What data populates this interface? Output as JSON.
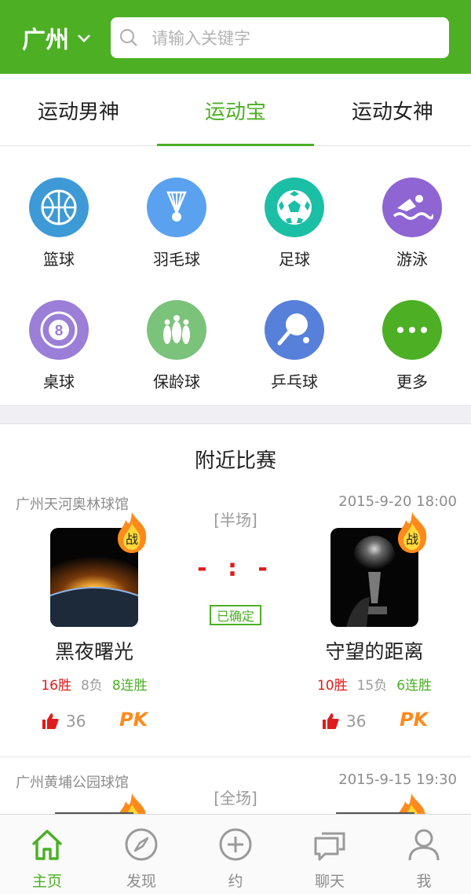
{
  "header": {
    "city": "广州",
    "search_placeholder": "请输入关键字"
  },
  "tabs": [
    {
      "label": "运动男神",
      "active": false
    },
    {
      "label": "运动宝",
      "active": true
    },
    {
      "label": "运动女神",
      "active": false
    }
  ],
  "categories": [
    {
      "label": "篮球",
      "icon": "basketball-icon",
      "color": "#3d9ad6"
    },
    {
      "label": "羽毛球",
      "icon": "badminton-icon",
      "color": "#5aa2ef"
    },
    {
      "label": "足球",
      "icon": "soccer-icon",
      "color": "#1bbfa6"
    },
    {
      "label": "游泳",
      "icon": "swimming-icon",
      "color": "#8e65d2"
    },
    {
      "label": "桌球",
      "icon": "billiards-icon",
      "color": "#9a7ed8"
    },
    {
      "label": "保龄球",
      "icon": "bowling-icon",
      "color": "#7bc27a"
    },
    {
      "label": "乒乓球",
      "icon": "pingpong-icon",
      "color": "#5680d9"
    },
    {
      "label": "更多",
      "icon": "more-icon",
      "color": "#4caf24"
    }
  ],
  "section_title": "附近比赛",
  "matches": [
    {
      "venue": "广州天河奥林球馆",
      "time": "2015-9-20   18:00",
      "mode": "[半场]",
      "score": "- : -",
      "status": "已确定",
      "badge": "战",
      "home": {
        "name": "黑夜曙光",
        "wins": "16胜",
        "losses": "8负",
        "streak": "8连胜",
        "likes": "36",
        "pk": "PK"
      },
      "away": {
        "name": "守望的距离",
        "wins": "10胜",
        "losses": "15负",
        "streak": "6连胜",
        "likes": "36",
        "pk": "PK"
      }
    },
    {
      "venue": "广州黄埔公园球馆",
      "time": "2015-9-15   19:30",
      "mode": "[全场]",
      "badge": "战"
    }
  ],
  "nav": [
    {
      "label": "主页",
      "icon": "home-icon",
      "active": true
    },
    {
      "label": "发现",
      "icon": "compass-icon",
      "active": false
    },
    {
      "label": "约",
      "icon": "plus-circle-icon",
      "active": false
    },
    {
      "label": "聊天",
      "icon": "chat-icon",
      "active": false
    },
    {
      "label": "我",
      "icon": "user-icon",
      "active": false
    }
  ],
  "colors": {
    "brand": "#4caf24",
    "win": "#e01b1b",
    "pk": "#ff8a1c"
  }
}
